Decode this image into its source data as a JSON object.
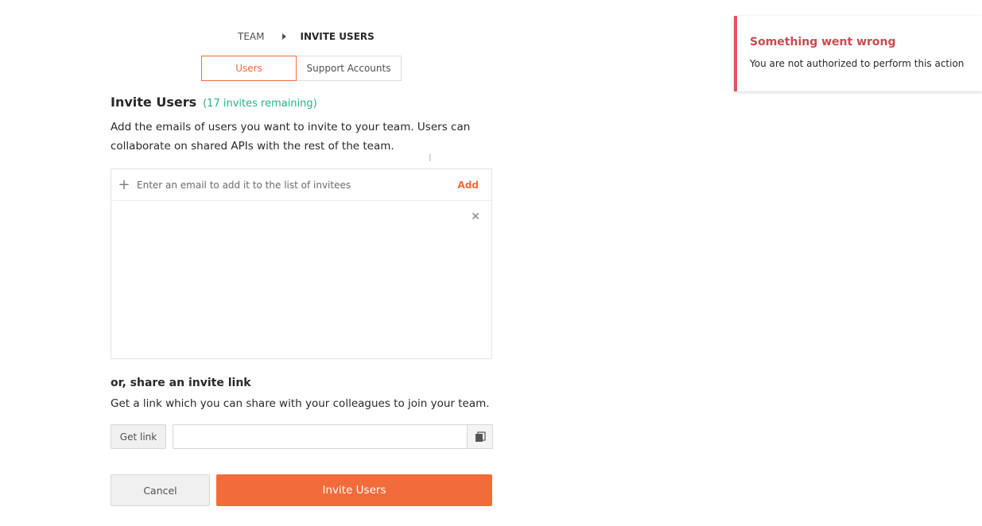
{
  "breadcrumb": {
    "parent": "TEAM",
    "current": "INVITE USERS"
  },
  "tabs": [
    {
      "label": "Users",
      "active": true
    },
    {
      "label": "Support Accounts",
      "active": false
    }
  ],
  "invite": {
    "title": "Invite Users",
    "remaining": "(17 invites remaining)",
    "description": "Add the emails of users you want to invite to your team. Users can collaborate on shared APIs with the rest of the team.",
    "email_placeholder": "Enter an email to add it to the list of invitees",
    "email_value": "",
    "add_label": "Add"
  },
  "share": {
    "title": "or, share an invite link",
    "description": "Get a link which you can share with your colleagues to join your team.",
    "get_link_label": "Get link",
    "link_value": ""
  },
  "actions": {
    "cancel_label": "Cancel",
    "invite_label": "Invite Users"
  },
  "toast": {
    "title": "Something went wrong",
    "message": "You are not authorized to perform this action"
  },
  "colors": {
    "accent": "#f26b3a",
    "success": "#26b47f",
    "error": "#e5555a"
  },
  "icons": {
    "breadcrumb_separator": "caret-right-icon",
    "add_email": "plus-icon",
    "clear": "close-icon",
    "copy": "copy-icon"
  }
}
